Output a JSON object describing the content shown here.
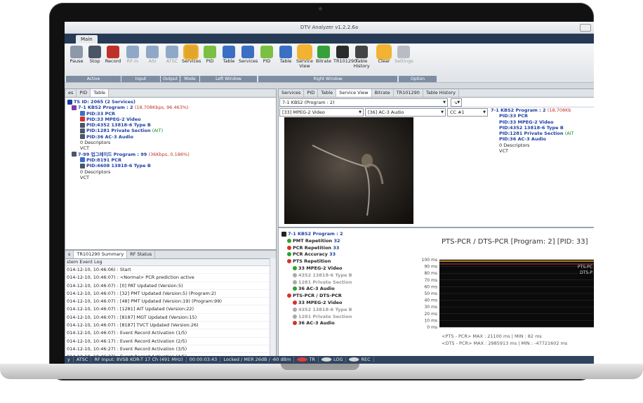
{
  "app": {
    "title": "DTV Analyzer v1.2.2.6a",
    "main_tab": "Main"
  },
  "ribbon": {
    "groups": [
      "Active",
      "Input",
      "Output",
      "Mode",
      "Left Window",
      "Right Window",
      "Option"
    ],
    "buttons": [
      {
        "label": "Pause",
        "icon": "pause-icon"
      },
      {
        "label": "Stop",
        "icon": "stop-icon"
      },
      {
        "label": "Record",
        "icon": "record-icon"
      },
      {
        "label": "RF-In",
        "icon": "rf-in-icon"
      },
      {
        "label": "ASI",
        "icon": "asi-icon"
      },
      {
        "label": "ATSC",
        "icon": "atsc-icon"
      },
      {
        "label": "Services",
        "icon": "tv-icon"
      },
      {
        "label": "PID",
        "icon": "pid-icon"
      },
      {
        "label": "Table",
        "icon": "table-icon"
      },
      {
        "label": "Services",
        "icon": "tv-icon"
      },
      {
        "label": "PID",
        "icon": "pid-icon"
      },
      {
        "label": "Table",
        "icon": "table-icon"
      },
      {
        "label": "Service View",
        "icon": "magnifier-icon"
      },
      {
        "label": "Bitrate",
        "icon": "bar-chart-icon"
      },
      {
        "label": "TR101290",
        "icon": "traffic-light-icon"
      },
      {
        "label": "Table History",
        "icon": "stack-icon"
      },
      {
        "label": "Clear",
        "icon": "warning-icon"
      },
      {
        "label": "Settings",
        "icon": "gear-icon"
      }
    ]
  },
  "left_top": {
    "tabs": [
      "es",
      "PID",
      "Table"
    ],
    "tree": [
      "TS ID: 2065 (2 Services)",
      "7-1 KBS2  Program : 2",
      "(18,708Kbps, 96.463%)",
      "PID:33 PCR",
      "PID:33 MPEG-2 Video",
      "PID:4352 13818-6 Type B",
      "PID:1281 Private Section",
      "(AIT)",
      "PID:36 AC-3 Audio",
      "0 Descriptors",
      "VCT",
      "7-99 업그레이드  Program : 99",
      "(36Kbps, 0.186%)",
      "PID:8191 PCR",
      "PID:4608 13818-6 Type B",
      "0 Descriptors",
      "VCT"
    ]
  },
  "left_bottom": {
    "tabs": [
      "s",
      "TR101290 Summary",
      "RF Status"
    ],
    "header": "stem Event Log",
    "log": [
      "014-12-10, 10:46:06) : Start",
      "014-12-10, 10:46:07) : <Normal> PCR prediction active",
      "014-12-10, 10:46:07) : [0] PAT Updated (Version:5)",
      "014-12-10, 10:46:07) : [32] PMT Updated (Version:5) (Program:2)",
      "014-12-10, 10:46:07) : [48] PMT Updated (Version:19) (Program:99)",
      "014-12-10, 10:46:07) : [1281] AIT Updated (Version:22)",
      "014-12-10, 10:46:07) : [8187] MGT Updated (Version:15)",
      "014-12-10, 10:46:07) : [8187] TVCT Updated (Version:26)",
      "014-12-10, 10:46:07) : Event Record Activation (1/5)",
      "014-12-10, 10:46:17) : Event Record Activation (2/5)",
      "014-12-10, 10:46:27) : Event Record Activation (3/5)",
      "014-12-10, 10:46:37) : Event Record Activation (4/5)",
      "014-12-10, 10:46:47) : Event Record Activation (5/5)"
    ]
  },
  "right_top": {
    "tabs": [
      "Services",
      "PID",
      "Table",
      "Service View",
      "Bitrate",
      "TR101290",
      "Table History"
    ],
    "service_select": "7-1 KBS2   (Program : 2)",
    "video_select": "[33] MPEG-2 Video",
    "audio_select": "[36] AC-3 Audio",
    "cc_select": "CC #1",
    "tree": [
      "7-1 KBS2  Program : 2",
      "(18,708Kb",
      "PID:33 PCR",
      "PID:33 MPEG-2 Video",
      "PID:4352 13818-6 Type B",
      "PID:1281 Private Section",
      "(AIT",
      "PID:36 AC-3 Audio",
      "0 Descriptors",
      "VCT"
    ]
  },
  "right_bottom": {
    "tree": [
      {
        "t": "7-1 KBS2  Program : 2",
        "c": "blue"
      },
      {
        "t": "PMT Repetition",
        "v": "32",
        "d": "#27a52c"
      },
      {
        "t": "PCR Repetition",
        "v": "33",
        "d": "#d3322b"
      },
      {
        "t": "PCR Accuracy",
        "v": "33",
        "d": "#27a52c"
      },
      {
        "t": "PTS Repetition",
        "d": "#d3322b"
      },
      {
        "t": "33 MPEG-2 Video",
        "d": "#27a52c"
      },
      {
        "t": "4352 13818-6 Type B",
        "d": "#aaaaaa"
      },
      {
        "t": "1281 Private Section",
        "d": "#aaaaaa"
      },
      {
        "t": "36 AC-3 Audio",
        "d": "#27a52c"
      },
      {
        "t": "PTS-PCR / DTS-PCR",
        "d": "#d3322b"
      },
      {
        "t": "33 MPEG-2 Video",
        "d": "#d3322b"
      },
      {
        "t": "4352 13818-6 Type B",
        "d": "#aaaaaa"
      },
      {
        "t": "1281 Private Section",
        "d": "#aaaaaa"
      },
      {
        "t": "36 AC-3 Audio",
        "d": "#d3322b"
      }
    ],
    "chart_title": "PTS-PCR / DTS-PCR [Program: 2] [PID: 33]",
    "chart_stat1": "<PTS - PCR> MAX : 21100 ms  |  MIN : 82 ms",
    "chart_stat2": "<DTS - PCR> MAX : 2985913 ms  |  MIN : -47721602 ms"
  },
  "chart_data": {
    "type": "line",
    "yticks": [
      "100 ms",
      "90 ms",
      "80 ms",
      "70 ms",
      "60 ms",
      "50 ms",
      "40 ms",
      "30 ms",
      "20 ms",
      "10 ms",
      "0 ms"
    ],
    "ylim": [
      0,
      100
    ],
    "series": [
      {
        "name": "PTS-PC"
      },
      {
        "name": "DTS-P"
      }
    ],
    "colors": {
      "pts": "#d9a52a",
      "dts": "#c23b3b"
    }
  },
  "status": {
    "items": [
      "y",
      "ATSC",
      "RF Input: 8VSB KOR-T 17 Ch (491 MHz)",
      "00:00:03:43",
      "Locked / MER 26dB / -60 dBm",
      "TR",
      "LOG",
      "REC"
    ]
  }
}
